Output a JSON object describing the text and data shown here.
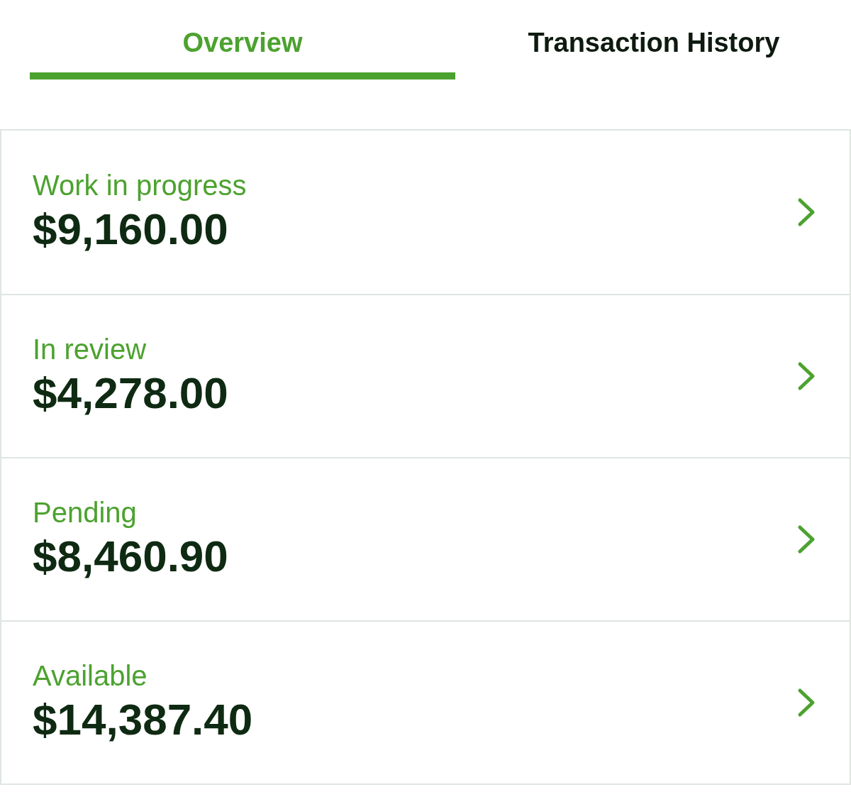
{
  "tabs": [
    {
      "label": "Overview",
      "selected": true
    },
    {
      "label": "Transaction History",
      "selected": false
    }
  ],
  "balances": [
    {
      "label": "Work in progress",
      "amount": "$9,160.00"
    },
    {
      "label": "In review",
      "amount": "$4,278.00"
    },
    {
      "label": "Pending",
      "amount": "$8,460.90"
    },
    {
      "label": "Available",
      "amount": "$14,387.40"
    }
  ]
}
